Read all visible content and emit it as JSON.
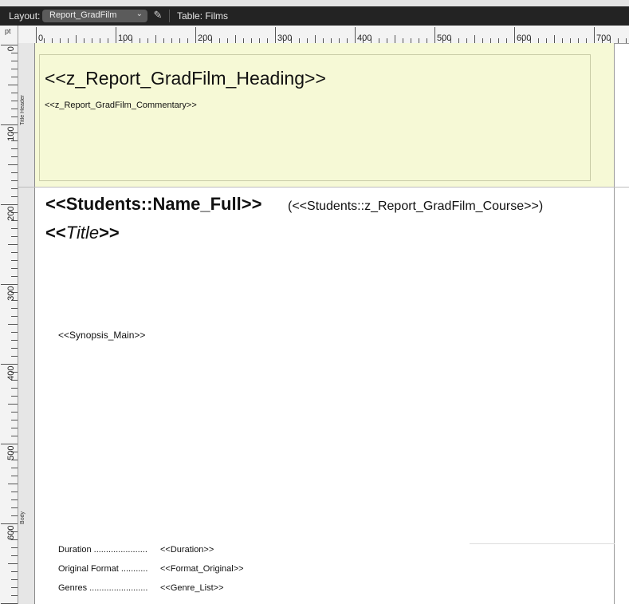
{
  "toolbar": {
    "layout_label": "Layout:",
    "layout_value": "Report_GradFilm",
    "table_label": "Table: Films"
  },
  "ruler": {
    "unit": "pt",
    "h_labels": [
      "0",
      "100",
      "200",
      "300",
      "400",
      "500",
      "600",
      "700"
    ],
    "v_labels": [
      "0",
      "100",
      "200",
      "300",
      "400",
      "500",
      "600"
    ]
  },
  "parts": {
    "header_label": "Title Header",
    "body_label": "Body"
  },
  "header": {
    "heading": "<<z_Report_GradFilm_Heading>>",
    "commentary": "<<z_Report_GradFilm_Commentary>>"
  },
  "body": {
    "name": "<<Students::Name_Full>>",
    "course": "(<<Students::z_Report_GradFilm_Course>>)",
    "title_open": "<<",
    "title_field": "Title",
    "title_close": ">>",
    "synopsis": "<<Synopsis_Main>>",
    "info": [
      {
        "label": "Duration ......................",
        "value": "<<Duration>>"
      },
      {
        "label": "Original Format ...........",
        "value": "<<Format_Original>>"
      },
      {
        "label": "Genres ........................",
        "value": "<<Genre_List>>"
      }
    ]
  }
}
